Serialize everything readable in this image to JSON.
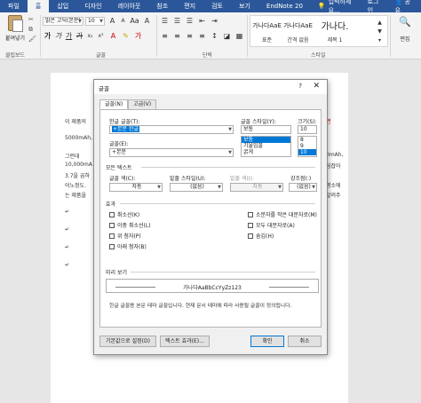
{
  "tabs": [
    "파일",
    "홈",
    "삽입",
    "디자인",
    "레이아웃",
    "참조",
    "편지",
    "검토",
    "보기",
    "EndNote 20"
  ],
  "search_placeholder": "입력하세요...",
  "login": "로그인",
  "share": "공유",
  "ribbon": {
    "paste": "붙여넣기",
    "clipboard": "클립보드",
    "font_group": "글꼴",
    "paragraph_group": "단락",
    "styles_group": "스타일",
    "edit": "편집",
    "font_name": "맑은 고딕(본문)",
    "font_size": "10",
    "styles": [
      {
        "sample": "가나다AaE",
        "name": "표준"
      },
      {
        "sample": "가나다AaE",
        "name": "간격 없음"
      },
      {
        "sample": "가나다.",
        "name": "제목 1"
      }
    ]
  },
  "doc": {
    "lines": [
      "이 제품의",
      "5000mAh,",
      "그런데",
      "10,000mA",
      "3.7을 곱하",
      "어노정도.",
      "는 제품을"
    ],
    "right_lines": [
      "면",
      "0mAh,",
      "팀잡아",
      "평소에",
      "알려주"
    ]
  },
  "dialog": {
    "title": "글꼴",
    "help": "?",
    "close": "✕",
    "tab_font": "글꼴(N)",
    "tab_advanced": "고급(V)",
    "hangul_font_label": "한글 글꼴(T):",
    "hangul_font_value": "+본문 한글",
    "font_label": "글꼴(E):",
    "font_value": "+본문",
    "style_label": "글꼴 스타일(Y):",
    "style_value": "보통",
    "style_options": [
      "보통",
      "기울임꼴",
      "굵게"
    ],
    "size_label": "크기(S):",
    "size_value": "10",
    "size_options": [
      "8",
      "9",
      "10"
    ],
    "all_text": "모든 텍스트",
    "color_label": "글꼴 색(C):",
    "color_value": "자동",
    "underline_style_label": "밑줄 스타일(U):",
    "underline_style_value": "(없음)",
    "underline_color_label": "밑줄 색(I):",
    "underline_color_value": "자동",
    "emphasis_label": "강조점(:)",
    "emphasis_value": "(없음)",
    "effects": "효과",
    "left_effects": [
      "취소선(K)",
      "이중 취소선(L)",
      "위 첨자(P)",
      "아래 첨자(B)"
    ],
    "right_effects": [
      "소문자를 작은 대문자로(M)",
      "모두 대문자로(A)",
      "숨김(H)"
    ],
    "preview_label": "미리 보기",
    "preview_text": "가나다AaBbCcYyZz123",
    "note": "한글 글꼴용 본문 테마 글꼴입니다. 현재 문서 테마에 따라 사용될 글꼴이 정의됩니다.",
    "btn_default": "기본값으로 설정(D)",
    "btn_effects": "텍스트 효과(E)...",
    "btn_ok": "확인",
    "btn_cancel": "취소"
  }
}
